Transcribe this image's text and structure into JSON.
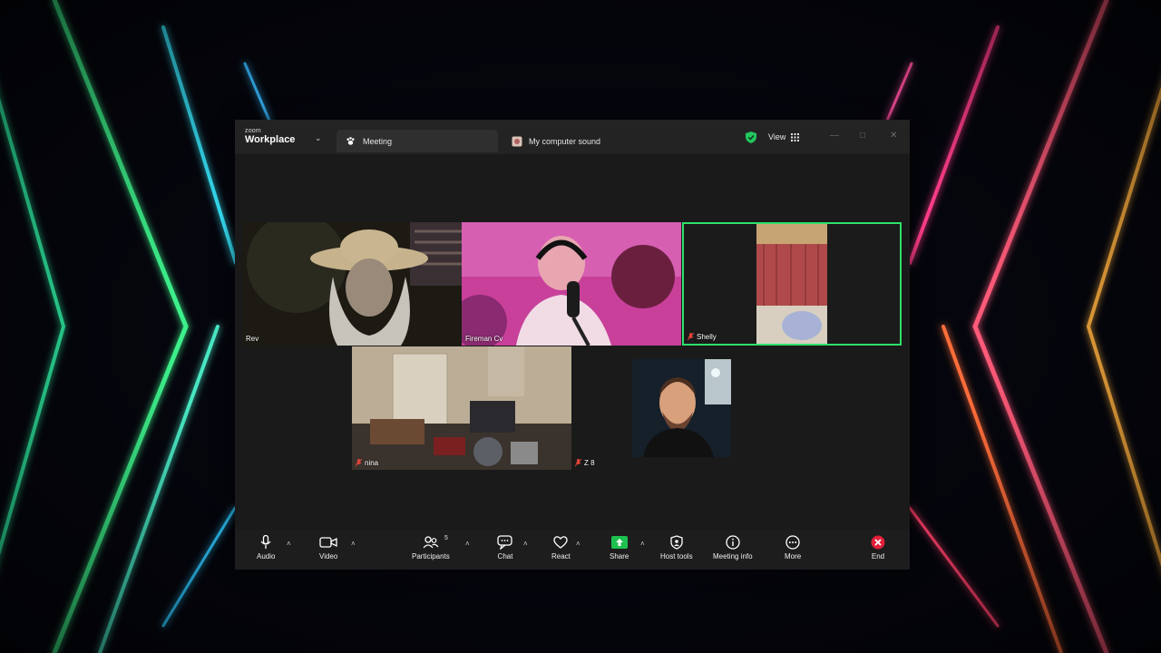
{
  "window": {
    "brand_top": "zoom",
    "brand_main": "Workplace",
    "tab_meeting": "Meeting",
    "tab_sound": "My computer sound",
    "view_label": "View"
  },
  "participants": [
    {
      "name": "Rev",
      "muted": false
    },
    {
      "name": "Fireman Cv",
      "muted": false
    },
    {
      "name": "Shelly",
      "muted": true,
      "active_speaker": true
    },
    {
      "name": "nina",
      "muted": true
    },
    {
      "name": "Z 8",
      "muted": true
    },
    {
      "name": "",
      "muted": false
    }
  ],
  "toolbar": {
    "audio": "Audio",
    "video": "Video",
    "participants": "Participants",
    "participants_count": "5",
    "chat": "Chat",
    "react": "React",
    "share": "Share",
    "host_tools": "Host tools",
    "meeting_info": "Meeting info",
    "more": "More",
    "end": "End"
  },
  "colors": {
    "active_speaker": "#2ee06a",
    "share": "#1ec04f",
    "end": "#e0203a",
    "mute": "#e0443a"
  }
}
